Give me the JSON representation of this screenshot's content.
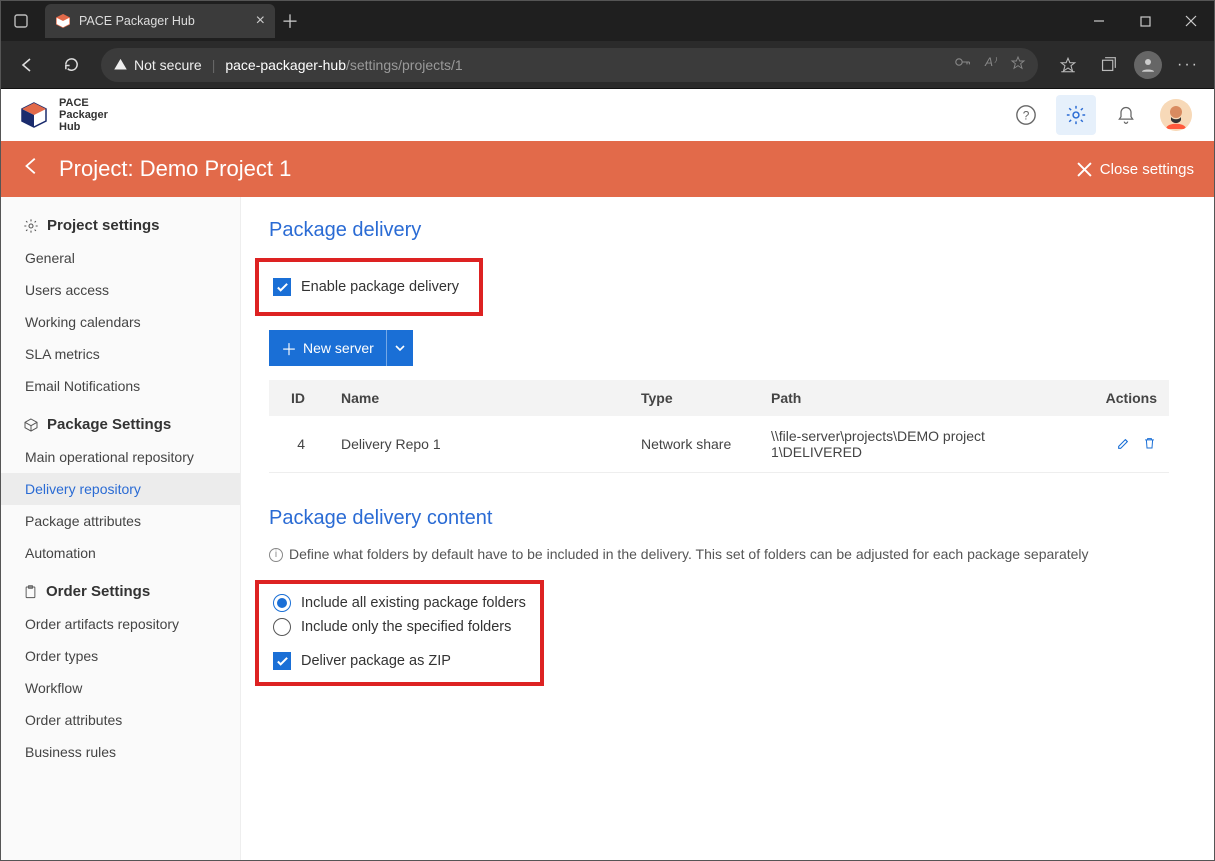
{
  "browser": {
    "tab_title": "PACE Packager Hub",
    "not_secure": "Not secure",
    "url_host": "pace-packager-hub",
    "url_path": "/settings/projects/1"
  },
  "logo": {
    "line1": "PACE",
    "line2": "Packager",
    "line3": "Hub"
  },
  "orange": {
    "title": "Project: Demo Project 1",
    "close": "Close settings"
  },
  "sidebar": {
    "group1": {
      "title": "Project settings",
      "items": [
        "General",
        "Users access",
        "Working calendars",
        "SLA metrics",
        "Email Notifications"
      ]
    },
    "group2": {
      "title": "Package Settings",
      "items": [
        "Main operational repository",
        "Delivery repository",
        "Package attributes",
        "Automation"
      ]
    },
    "group3": {
      "title": "Order Settings",
      "items": [
        "Order artifacts repository",
        "Order types",
        "Workflow",
        "Order attributes",
        "Business rules"
      ]
    }
  },
  "section1": {
    "title": "Package delivery",
    "enable_label": "Enable package delivery",
    "new_server": "New server",
    "cols": {
      "id": "ID",
      "name": "Name",
      "type": "Type",
      "path": "Path",
      "actions": "Actions"
    },
    "row": {
      "id": "4",
      "name": "Delivery Repo 1",
      "type": "Network share",
      "path": "\\\\file-server\\projects\\DEMO project 1\\DELIVERED"
    }
  },
  "section2": {
    "title": "Package delivery content",
    "info": "Define what folders by default have to be included in the delivery. This set of folders can be adjusted for each package separately",
    "opt1": "Include all existing package folders",
    "opt2": "Include only the specified folders",
    "zip": "Deliver package as ZIP"
  }
}
